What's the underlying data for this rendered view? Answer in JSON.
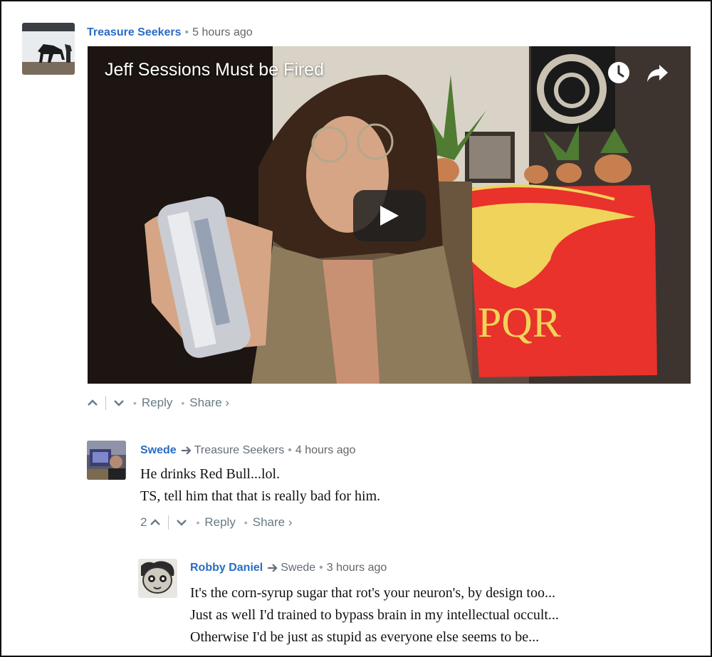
{
  "comments": [
    {
      "author": "Treasure Seekers",
      "time": "5 hours ago",
      "video": {
        "title": "Jeff Sessions Must be Fired",
        "flag_text": "PQR"
      },
      "actions": {
        "reply": "Reply",
        "share": "Share ›"
      }
    },
    {
      "author": "Swede",
      "reply_to": "Treasure Seekers",
      "time": "4 hours ago",
      "lines": [
        "He drinks Red Bull...lol.",
        "TS, tell him that that is really bad for him."
      ],
      "upvotes": "2",
      "actions": {
        "reply": "Reply",
        "share": "Share ›"
      }
    },
    {
      "author": "Robby Daniel",
      "reply_to": "Swede",
      "time": "3 hours ago",
      "lines": [
        "It's the corn-syrup sugar that rot's your neuron's, by design too...",
        "Just as well I'd trained to bypass brain in my intellectual occult...",
        "Otherwise I'd be just as stupid as everyone else seems to be..."
      ]
    }
  ],
  "colors": {
    "author": "#2a6cc4",
    "meta": "#656c7a",
    "action": "#687a86",
    "flag": "#e8322b"
  },
  "icons": [
    "up-arrow-icon",
    "down-arrow-icon",
    "reply-arrow-icon",
    "clock-icon",
    "share-icon",
    "play-icon"
  ]
}
